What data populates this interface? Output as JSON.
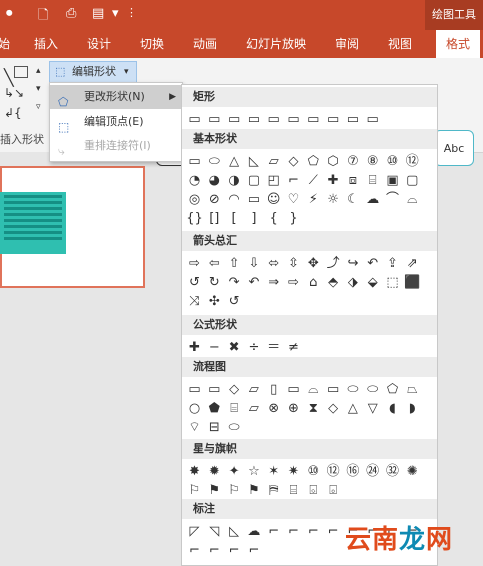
{
  "titlebar": {
    "context_title": "绘图工具",
    "quick_access": [
      "record-icon",
      "new-doc-icon",
      "print-preview-icon",
      "screenshot-icon",
      "dropdown-icon"
    ]
  },
  "tabs": [
    {
      "label": "始",
      "active": false
    },
    {
      "label": "插入",
      "active": false
    },
    {
      "label": "设计",
      "active": false
    },
    {
      "label": "切换",
      "active": false
    },
    {
      "label": "动画",
      "active": false
    },
    {
      "label": "幻灯片放映",
      "active": false
    },
    {
      "label": "审阅",
      "active": false
    },
    {
      "label": "视图",
      "active": false
    },
    {
      "label": "格式",
      "active": true
    }
  ],
  "ribbon": {
    "edit_shape_label": "编辑形状",
    "insert_shape_group": "插入形状",
    "style_preview_label": "Abc",
    "style_colors": [
      "#333333",
      "#e05a4a",
      "#f0b84a",
      "#9fc38a",
      "#4fb8c8"
    ]
  },
  "submenu": {
    "items": [
      {
        "label": "更改形状(N)",
        "highlighted": true,
        "disabled": false,
        "icon": "change-shape-icon"
      },
      {
        "label": "编辑顶点(E)",
        "highlighted": false,
        "disabled": false,
        "icon": "edit-points-icon"
      },
      {
        "label": "重排连接符(I)",
        "highlighted": false,
        "disabled": true,
        "icon": "reroute-connectors-icon"
      }
    ]
  },
  "gallery": {
    "sections": [
      {
        "title": "矩形",
        "rows": [
          [
            "▭",
            "▭",
            "▭",
            "▭",
            "▭",
            "▭",
            "▭",
            "▭",
            "▭",
            "▭"
          ]
        ]
      },
      {
        "title": "基本形状",
        "rows": [
          [
            "▭",
            "⬭",
            "△",
            "◺",
            "▱",
            "◇",
            "⬠",
            "⬡",
            "⑦",
            "⑧",
            "⑩",
            "⑫"
          ],
          [
            "◔",
            "◕",
            "◑",
            "▢",
            "◰",
            "⌐",
            "⟋",
            "✚",
            "⧈",
            "⌸",
            "▣",
            "▢"
          ],
          [
            "◎",
            "⊘",
            "◠",
            "▭",
            "☺",
            "♡",
            "⚡",
            "☼",
            "☾",
            "☁",
            "⌒",
            "⌓"
          ],
          [
            "{}",
            "[]",
            "[",
            "]",
            "{",
            "}"
          ]
        ]
      },
      {
        "title": "箭头总汇",
        "rows": [
          [
            "⇨",
            "⇦",
            "⇧",
            "⇩",
            "⬄",
            "⇳",
            "✥",
            "⤴",
            "↪",
            "↶",
            "⇪",
            "⇗"
          ],
          [
            "↺",
            "↻",
            "↷",
            "↶",
            "⇒",
            "⇨",
            "⌂",
            "⬘",
            "⬗",
            "⬙",
            "⬚",
            "⬛"
          ],
          [
            "⤨",
            "✣",
            "↺"
          ]
        ]
      },
      {
        "title": "公式形状",
        "rows": [
          [
            "✚",
            "−",
            "✖",
            "÷",
            "＝",
            "≠"
          ]
        ]
      },
      {
        "title": "流程图",
        "rows": [
          [
            "▭",
            "▭",
            "◇",
            "▱",
            "▯",
            "▭",
            "⌓",
            "▭",
            "⬭",
            "⬭",
            "⬠",
            "⏢"
          ],
          [
            "○",
            "⬟",
            "⌸",
            "⏥",
            "⊗",
            "⊕",
            "⧗",
            "◇",
            "△",
            "▽",
            "◖",
            "◗"
          ],
          [
            "⌔",
            "⊟",
            "⬭"
          ]
        ]
      },
      {
        "title": "星与旗帜",
        "rows": [
          [
            "✸",
            "✹",
            "✦",
            "☆",
            "✶",
            "✷",
            "⑩",
            "⑫",
            "⑯",
            "㉔",
            "㉜",
            "✺"
          ],
          [
            "⚐",
            "⚑",
            "⚐",
            "⚑",
            "⛿",
            "⌸",
            "⌺",
            "⌻"
          ]
        ]
      },
      {
        "title": "标注",
        "rows": [
          [
            "◸",
            "◹",
            "◺",
            "☁",
            "⌐",
            "⌐",
            "⌐",
            "⌐",
            "⌐",
            "⌐",
            "⌐",
            "⌐"
          ],
          [
            "⌐",
            "⌐",
            "⌐",
            "⌐"
          ]
        ]
      }
    ]
  },
  "watermark": {
    "text_a": "云南",
    "text_b": "龙",
    "text_c": "网"
  }
}
